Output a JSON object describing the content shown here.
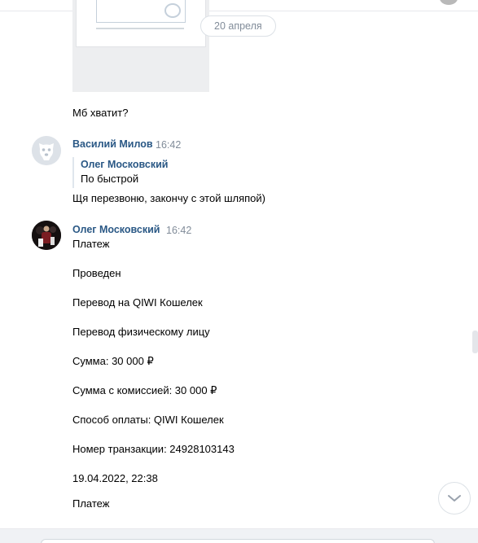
{
  "conversation": {
    "date_divider": "20 апреля",
    "messages": [
      {
        "text": "Мб хватит?"
      },
      {
        "author": "Василий Милов",
        "time": "16:42",
        "reply_quote": {
          "author": "Олег Московский",
          "text": "По быстрой"
        },
        "text": "Щя перезвоню, закончу с этой шляпой)"
      },
      {
        "author": "Олег Московский",
        "time": "16:42",
        "lines": [
          "Платеж",
          "Проведен",
          "Перевод на QIWI Кошелек",
          "Перевод физическому лицу",
          "Сумма: 30 000 ₽",
          "Сумма с комиссией: 30 000 ₽",
          "Способ оплаты: QIWI Кошелек",
          "Номер транзакции: 24928103143",
          "19.04.2022, 22:38",
          "Платеж"
        ]
      }
    ]
  },
  "icons": {
    "avatar_default": "vk-dog-avatar-icon",
    "scroll_down": "chevron-down-icon"
  },
  "colors": {
    "author_link": "#2a5885",
    "time_gray": "#818c99",
    "divider": "#e7e8ec"
  }
}
